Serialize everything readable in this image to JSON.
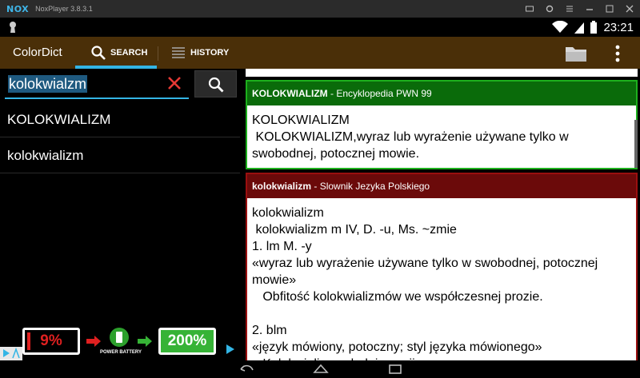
{
  "window": {
    "logo": "NOX",
    "title": "NoxPlayer 3.8.3.1"
  },
  "status": {
    "time": "23:21"
  },
  "app": {
    "title": "ColorDict",
    "tabs": [
      {
        "label": "SEARCH",
        "icon": "search-icon",
        "active": true
      },
      {
        "label": "HISTORY",
        "icon": "list-icon",
        "active": false
      }
    ],
    "accent": "#33b5e5",
    "bar_color": "#4a2f08"
  },
  "search": {
    "value": "kolokwialzm"
  },
  "results": [
    "KOLOKWIALIZM",
    "kolokwializm"
  ],
  "ad": {
    "battery_low": "9%",
    "battery_high": "200%",
    "caption": "POWER BATTERY",
    "colors": {
      "low": "#e02020",
      "high": "#36b336"
    }
  },
  "entries": [
    {
      "headword": "KOLOKWIALIZM",
      "source": " - Encyklopedia PWN 99",
      "body": "KOLOKWIALIZM\n KOLOKWIALIZM,wyraz lub wyrażenie używane tylko w swobodnej, potocznej mowie.",
      "color": "#0a6b0a"
    },
    {
      "headword": "kolokwializm",
      "source": " - Slownik Jezyka Polskiego",
      "body": "kolokwializm\n kolokwializm m IV, D. -u, Ms. ~zmie\n1. lm M. -y\n«wyraz lub wyrażenie używane tylko w swobodnej, potocznej mowie»\n   Obfitość kolokwializmów we współczesnej prozie.\n\n2. blm\n«język mówiony, potoczny; styl języka mówionego»\n   Kolokwializm młodej poezji.",
      "color": "#6b0a0a"
    }
  ]
}
